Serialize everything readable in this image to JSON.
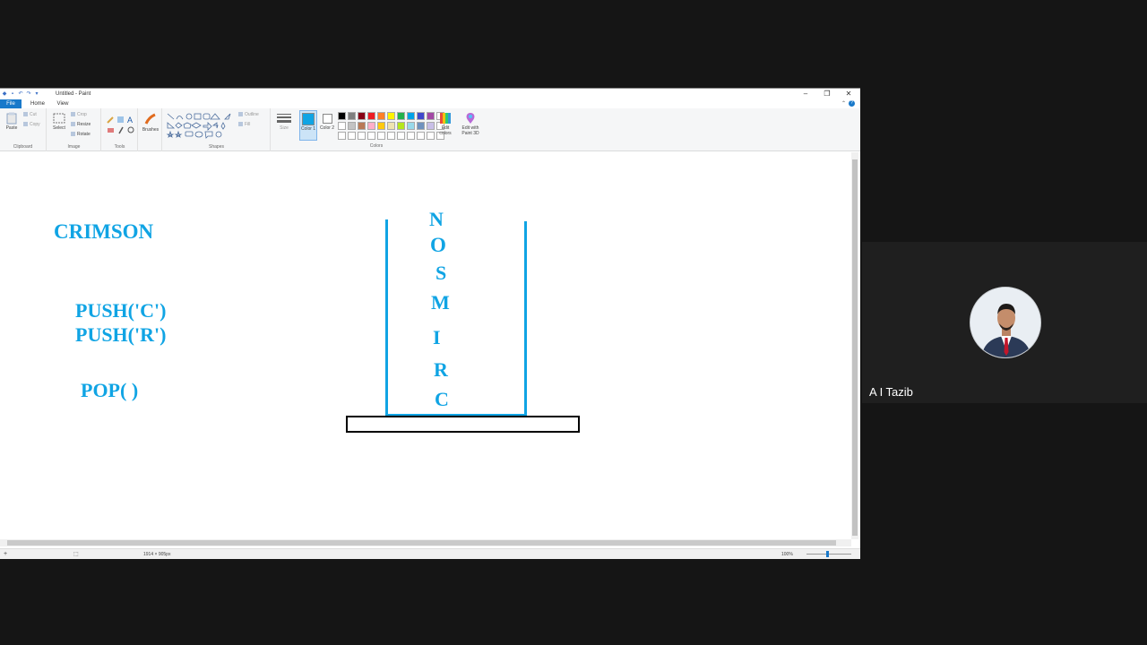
{
  "window": {
    "title": "Untitled - Paint",
    "controls": {
      "minimize": "–",
      "restore": "❐",
      "close": "✕"
    }
  },
  "tabs": {
    "file": "File",
    "home": "Home",
    "view": "View"
  },
  "ribbon": {
    "clipboard": {
      "paste": "Paste",
      "cut": "Cut",
      "copy": "Copy",
      "label": "Clipboard"
    },
    "image": {
      "select": "Select",
      "crop": "Crop",
      "resize": "Resize",
      "rotate": "Rotate",
      "label": "Image"
    },
    "tools": {
      "label": "Tools"
    },
    "brushes": {
      "label": "Brushes"
    },
    "shapes": {
      "outline": "Outline",
      "fill": "Fill",
      "label": "Shapes"
    },
    "size": {
      "label": "Size"
    },
    "color1": {
      "label": "Color 1"
    },
    "color2": {
      "label": "Color 2"
    },
    "colors": {
      "edit": "Edit colors",
      "label": "Colors"
    },
    "paint3d": {
      "label": "Edit with Paint 3D"
    },
    "palette": [
      "#000000",
      "#7f7f7f",
      "#880015",
      "#ed1c24",
      "#ff7f27",
      "#fff200",
      "#22b14c",
      "#00a2e8",
      "#3f48cc",
      "#a349a4",
      "#ffffff",
      "#ffffff",
      "#c3c3c3",
      "#b97a57",
      "#ffaec9",
      "#ffc90e",
      "#efe4b0",
      "#b5e61d",
      "#99d9ea",
      "#7092be",
      "#c8bfe7",
      "#ffffff",
      "#ffffff",
      "#ffffff",
      "#ffffff",
      "#ffffff",
      "#ffffff",
      "#ffffff",
      "#ffffff",
      "#ffffff",
      "#ffffff",
      "#ffffff",
      "#ffffff"
    ]
  },
  "canvas": {
    "word": "CRIMSON",
    "push1": "PUSH('C')",
    "push2": "PUSH('R')",
    "pop": "POP( )",
    "stack_letters": [
      "N",
      "O",
      "S",
      "M",
      "I",
      "R",
      "C"
    ],
    "ink_color": "#10a4e4"
  },
  "status": {
    "dimensions": "1914 × 905px",
    "zoom": "100%"
  },
  "participant": {
    "name": "A I Tazib"
  }
}
